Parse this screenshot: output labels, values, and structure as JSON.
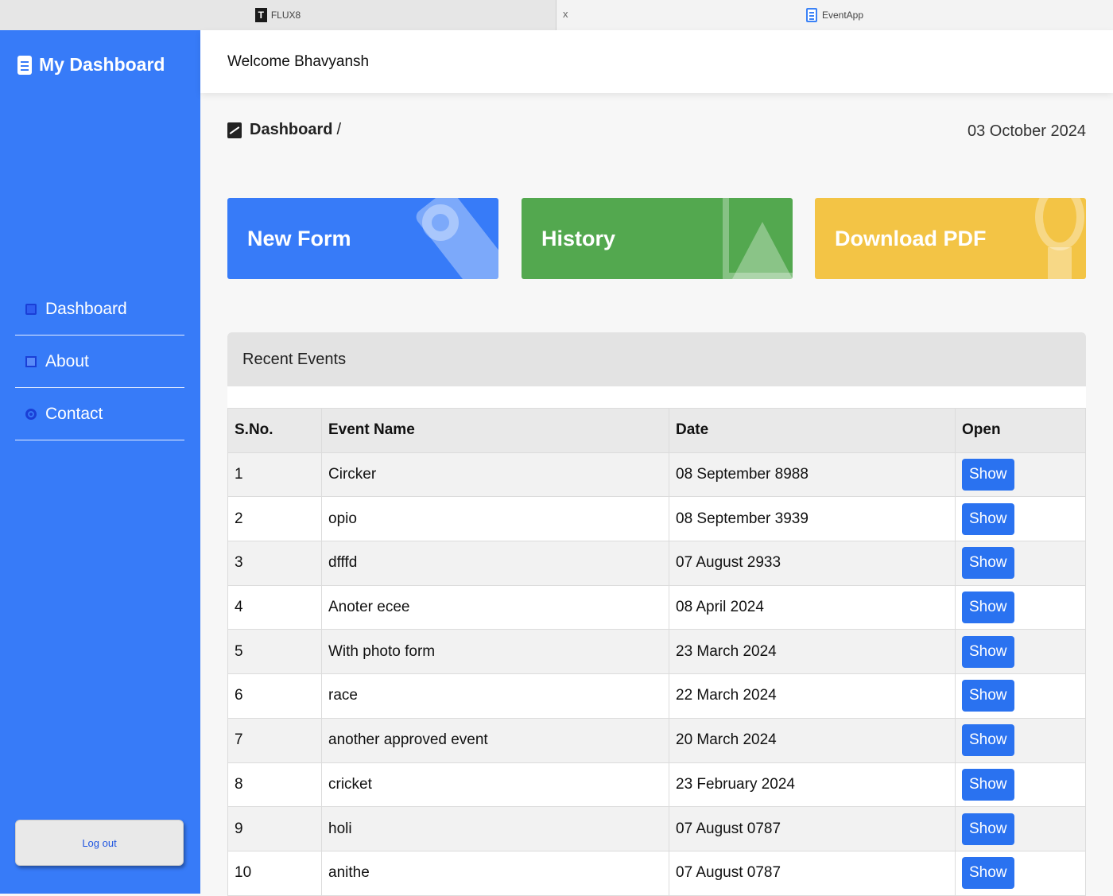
{
  "browser": {
    "tabs": [
      {
        "label": "FLUX8",
        "icon": "t-logo-icon"
      },
      {
        "label": "EventApp",
        "icon": "document-icon",
        "close": "x"
      }
    ]
  },
  "sidebar": {
    "brand": "My Dashboard",
    "items": [
      {
        "label": "Dashboard",
        "icon": "calendar-icon"
      },
      {
        "label": "About",
        "icon": "image-icon"
      },
      {
        "label": "Contact",
        "icon": "gear-icon"
      }
    ],
    "logout": "Log out"
  },
  "header": {
    "welcome": "Welcome Bhavyansh"
  },
  "breadcrumb": {
    "label": "Dashboard",
    "separator": "/",
    "date": "03 October 2024"
  },
  "cards": [
    {
      "label": "New Form",
      "color": "#377bf8",
      "icon": "tools-icon"
    },
    {
      "label": "History",
      "color": "#53a84f",
      "icon": "picture-icon"
    },
    {
      "label": "Download PDF",
      "color": "#f3c445",
      "icon": "lightbulb-icon"
    }
  ],
  "events": {
    "title": "Recent Events",
    "columns": [
      "S.No.",
      "Event Name",
      "Date",
      "Open"
    ],
    "rows": [
      [
        "1",
        "Circker",
        "08 September 8988",
        "Show"
      ],
      [
        "2",
        "opio",
        "08 September 3939",
        "Show"
      ],
      [
        "3",
        "dfffd",
        "07 August 2933",
        "Show"
      ],
      [
        "4",
        "Anoter ecee",
        "08 April 2024",
        "Show"
      ],
      [
        "5",
        "With photo form",
        "23 March 2024",
        "Show"
      ],
      [
        "6",
        "race",
        "22 March 2024",
        "Show"
      ],
      [
        "7",
        "another approved event",
        "20 March 2024",
        "Show"
      ],
      [
        "8",
        "cricket",
        "23 February 2024",
        "Show"
      ],
      [
        "9",
        "holi",
        "07 August 0787",
        "Show"
      ],
      [
        "10",
        "anithe",
        "07 August 0787",
        "Show"
      ]
    ]
  },
  "colors": {
    "sidebar": "#377bf8",
    "show_button": "#2a72f0"
  }
}
